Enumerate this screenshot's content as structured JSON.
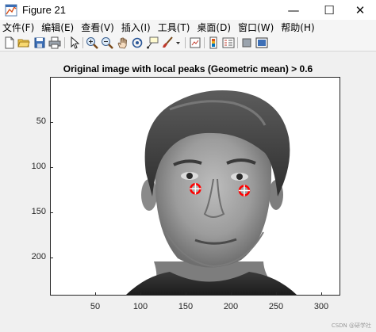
{
  "window": {
    "title": "Figure 21",
    "controls": {
      "minimize": "—",
      "maximize": "☐",
      "close": "✕"
    }
  },
  "menu": {
    "items": [
      {
        "label": "文件(F)"
      },
      {
        "label": "编辑(E)"
      },
      {
        "label": "查看(V)"
      },
      {
        "label": "插入(I)"
      },
      {
        "label": "工具(T)"
      },
      {
        "label": "桌面(D)"
      },
      {
        "label": "窗口(W)"
      },
      {
        "label": "帮助(H)"
      }
    ]
  },
  "toolbar": {
    "icons": [
      "new-figure-icon",
      "open-file-icon",
      "save-icon",
      "print-icon",
      "select-arrow-icon",
      "zoom-in-icon",
      "zoom-out-icon",
      "pan-hand-icon",
      "rotate-3d-icon",
      "data-cursor-icon",
      "brush-icon",
      "brush-dropdown-icon",
      "link-plot-icon",
      "insert-colorbar-icon",
      "insert-legend-icon",
      "hide-plot-tools-icon",
      "show-plot-tools-icon"
    ]
  },
  "plot": {
    "title": "Original image with local peaks (Geometric mean) > 0.6",
    "x_ticks": [
      "50",
      "100",
      "150",
      "200",
      "250",
      "300"
    ],
    "y_ticks": [
      "50",
      "100",
      "150",
      "200"
    ],
    "image": "grayscale face photograph",
    "peaks": [
      {
        "x": 160,
        "y": 123
      },
      {
        "x": 214,
        "y": 125
      }
    ],
    "marker_color": "#ff0000",
    "marker_cross_color": "#ffffff"
  },
  "watermark": "CSDN @研学社"
}
